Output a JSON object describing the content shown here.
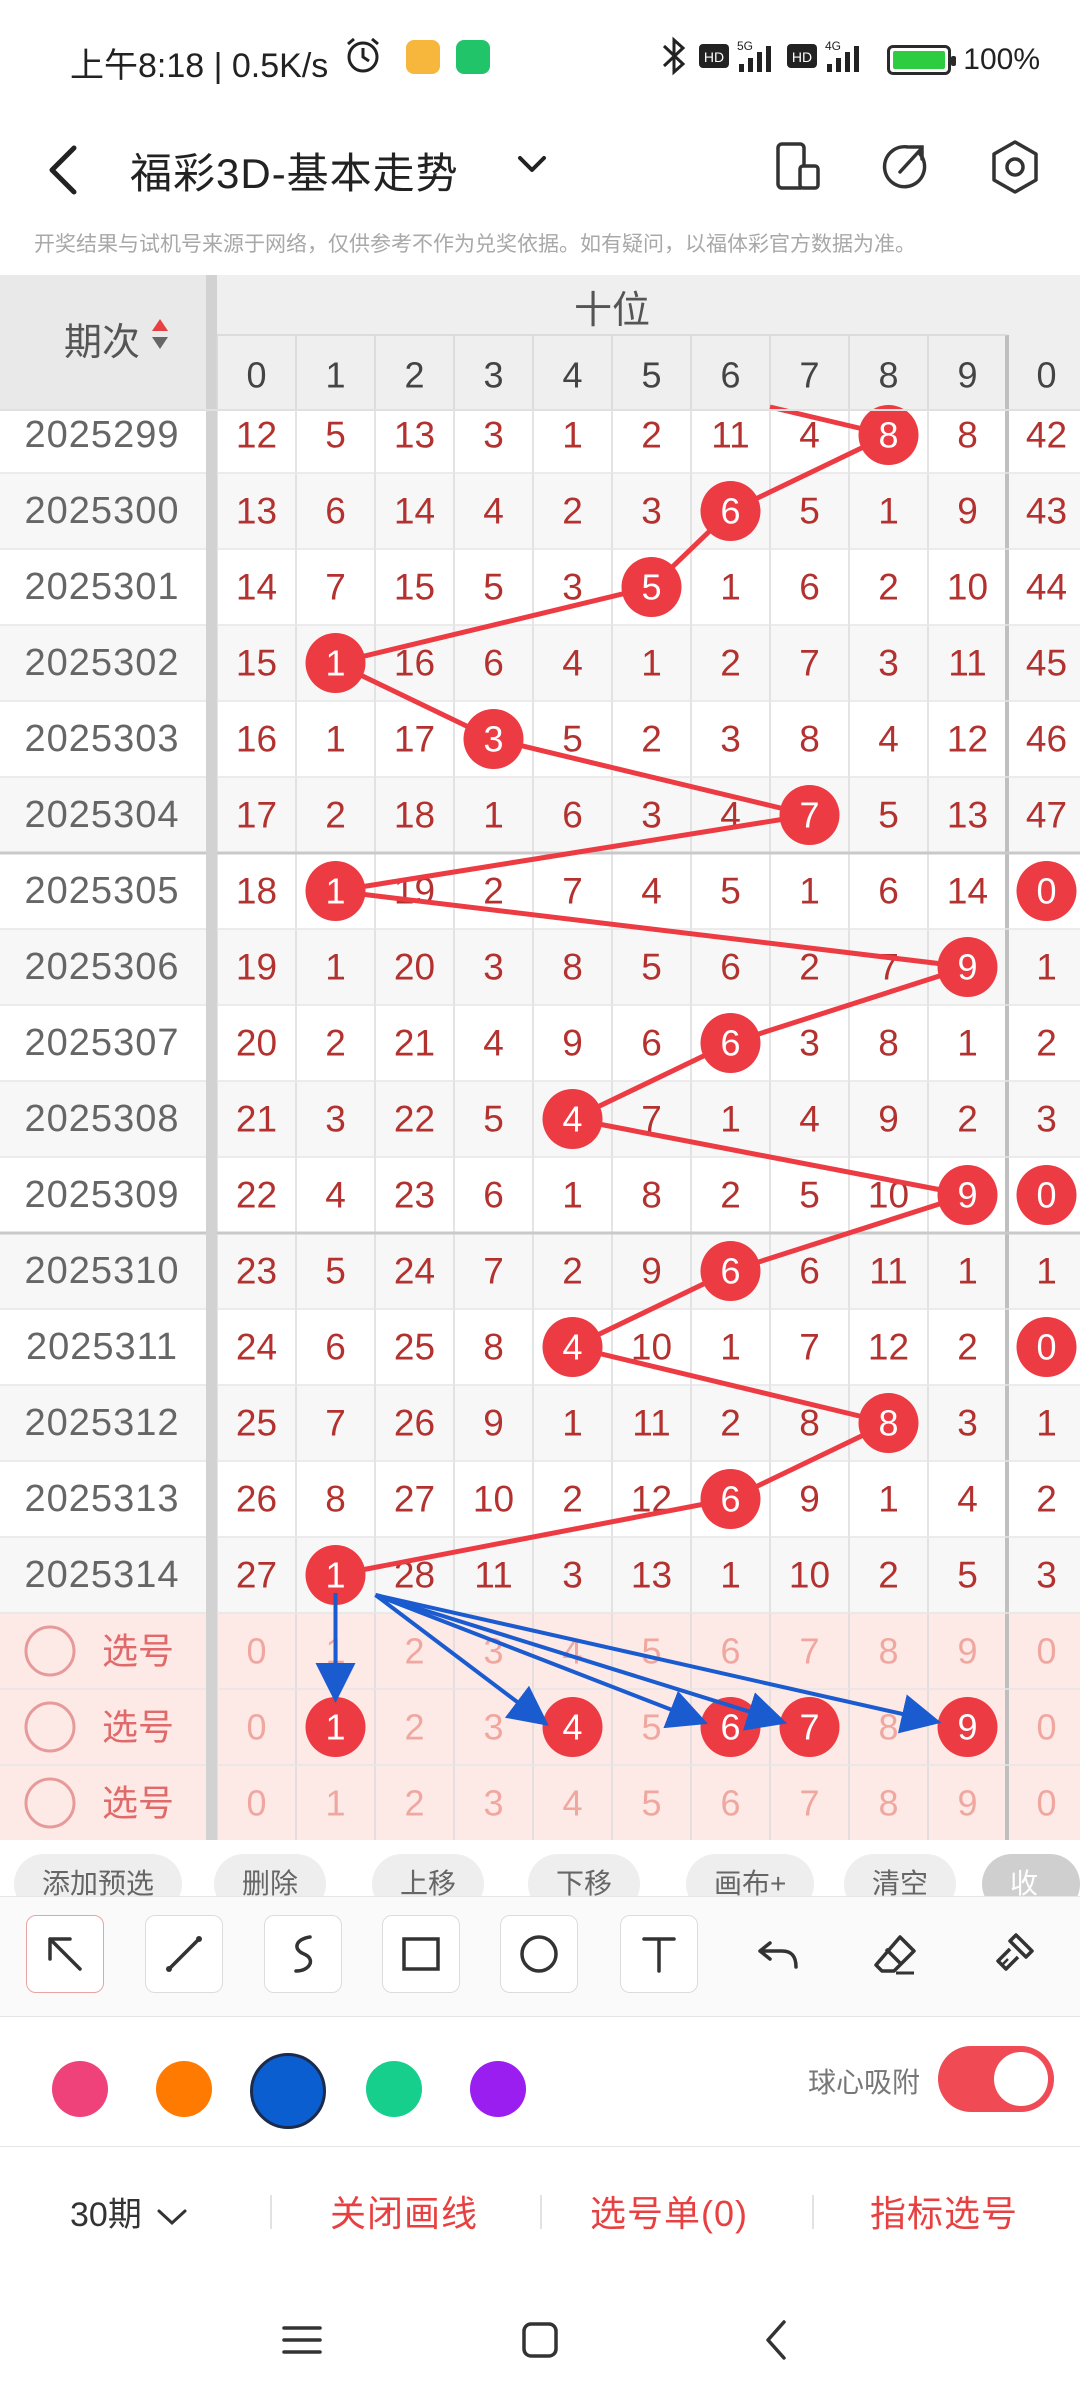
{
  "status_bar": {
    "time": "上午8:18 | 0.5K/s",
    "battery": "100%",
    "net_labels": [
      "HD",
      "5G",
      "HD",
      "4G"
    ]
  },
  "header": {
    "title": "福彩3D-基本走势",
    "back_icon": "chevron-left-icon",
    "dropdown_icon": "chevron-down-icon",
    "icons": [
      "device-switch-icon",
      "share-icon",
      "settings-icon"
    ]
  },
  "disclaimer": "开奖结果与试机号来源于网络，仅供参考不作为兑奖依据。如有疑问，以福体彩官方数据为准。",
  "table": {
    "period_header": "期次",
    "section_header": "十位",
    "digit_headers": [
      "0",
      "1",
      "2",
      "3",
      "4",
      "5",
      "6",
      "7",
      "8",
      "9",
      "0"
    ],
    "rows": [
      {
        "period": "2025299",
        "values": [
          "12",
          "5",
          "13",
          "3",
          "1",
          "2",
          "11",
          "4",
          "8",
          "8",
          "42"
        ],
        "hit": 8
      },
      {
        "period": "2025300",
        "values": [
          "13",
          "6",
          "14",
          "4",
          "2",
          "3",
          "6",
          "5",
          "1",
          "9",
          "43"
        ],
        "hit": 6
      },
      {
        "period": "2025301",
        "values": [
          "14",
          "7",
          "15",
          "5",
          "3",
          "5",
          "1",
          "6",
          "2",
          "10",
          "44"
        ],
        "hit": 5
      },
      {
        "period": "2025302",
        "values": [
          "15",
          "1",
          "16",
          "6",
          "4",
          "1",
          "2",
          "7",
          "3",
          "11",
          "45"
        ],
        "hit": 1
      },
      {
        "period": "2025303",
        "values": [
          "16",
          "1",
          "17",
          "3",
          "5",
          "2",
          "3",
          "8",
          "4",
          "12",
          "46"
        ],
        "hit": 3
      },
      {
        "period": "2025304",
        "values": [
          "17",
          "2",
          "18",
          "1",
          "6",
          "3",
          "4",
          "7",
          "5",
          "13",
          "47"
        ],
        "hit": 7
      },
      {
        "period": "2025305",
        "values": [
          "18",
          "1",
          "19",
          "2",
          "7",
          "4",
          "5",
          "1",
          "6",
          "14",
          "0"
        ],
        "hit": 1,
        "extra_hit": true
      },
      {
        "period": "2025306",
        "values": [
          "19",
          "1",
          "20",
          "3",
          "8",
          "5",
          "6",
          "2",
          "7",
          "9",
          "1"
        ],
        "hit": 9
      },
      {
        "period": "2025307",
        "values": [
          "20",
          "2",
          "21",
          "4",
          "9",
          "6",
          "6",
          "3",
          "8",
          "1",
          "2"
        ],
        "hit": 6
      },
      {
        "period": "2025308",
        "values": [
          "21",
          "3",
          "22",
          "5",
          "4",
          "7",
          "1",
          "4",
          "9",
          "2",
          "3"
        ],
        "hit": 4
      },
      {
        "period": "2025309",
        "values": [
          "22",
          "4",
          "23",
          "6",
          "1",
          "8",
          "2",
          "5",
          "10",
          "9",
          "0"
        ],
        "hit": 9,
        "extra_hit": true
      },
      {
        "period": "2025310",
        "values": [
          "23",
          "5",
          "24",
          "7",
          "2",
          "9",
          "6",
          "6",
          "11",
          "1",
          "1"
        ],
        "hit": 6
      },
      {
        "period": "2025311",
        "values": [
          "24",
          "6",
          "25",
          "8",
          "4",
          "10",
          "1",
          "7",
          "12",
          "2",
          "0"
        ],
        "hit": 4,
        "extra_hit": true
      },
      {
        "period": "2025312",
        "values": [
          "25",
          "7",
          "26",
          "9",
          "1",
          "11",
          "2",
          "8",
          "8",
          "3",
          "1"
        ],
        "hit": 8
      },
      {
        "period": "2025313",
        "values": [
          "26",
          "8",
          "27",
          "10",
          "2",
          "12",
          "6",
          "9",
          "1",
          "4",
          "2"
        ],
        "hit": 6
      },
      {
        "period": "2025314",
        "values": [
          "27",
          "1",
          "28",
          "11",
          "3",
          "13",
          "1",
          "10",
          "2",
          "5",
          "3"
        ],
        "hit": 1
      }
    ],
    "pick_label": "选号",
    "pick_rows": [
      {
        "digits": [
          "0",
          "1",
          "2",
          "3",
          "4",
          "5",
          "6",
          "7",
          "8",
          "9",
          "0"
        ],
        "selected": []
      },
      {
        "digits": [
          "0",
          "1",
          "2",
          "3",
          "4",
          "5",
          "6",
          "7",
          "8",
          "9",
          "0"
        ],
        "selected": [
          1,
          4,
          6,
          7,
          9
        ]
      },
      {
        "digits": [
          "0",
          "1",
          "2",
          "3",
          "4",
          "5",
          "6",
          "7",
          "8",
          "9",
          "0"
        ],
        "selected": []
      }
    ]
  },
  "quick_actions": [
    "添加预选",
    "删除",
    "上移",
    "下移",
    "画布+",
    "清空",
    "收起"
  ],
  "tools": [
    "select-arrow-icon",
    "line-icon",
    "freehand-icon",
    "rectangle-icon",
    "circle-icon",
    "text-icon",
    "undo-icon",
    "eraser-icon",
    "clear-brush-icon"
  ],
  "colors": {
    "accent_red": "#e84040",
    "ball_red": "#ec3b43",
    "draw_blue": "#1a5bd0",
    "palette": [
      "#f0427a",
      "#ff7a00",
      "#0a5ed0",
      "#17cf8c",
      "#9a1ef0"
    ]
  },
  "snap_label": "球心吸附",
  "bottom": {
    "period_select": "30期",
    "close_lines": "关闭画线",
    "pick_list": "选号单(0)",
    "indicator_pick": "指标选号"
  },
  "system_nav": [
    "menu-icon",
    "home-icon",
    "back-icon"
  ]
}
